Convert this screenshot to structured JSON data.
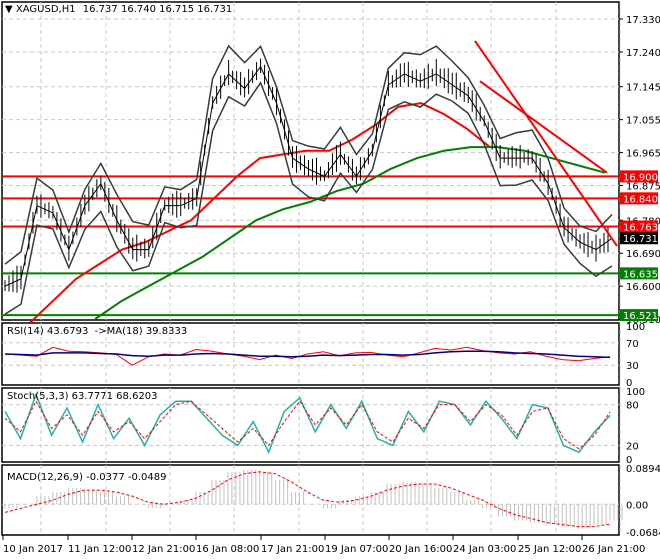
{
  "header": {
    "symbol_label": "XAGUSD,H1",
    "ohlc": "16.737 16.740 16.715 16.731"
  },
  "colors": {
    "up_down_bars": "#000000",
    "bands": "#2f3f3f",
    "ma_fast": "#ff0000",
    "ma_slow": "#008000",
    "resistance": "#ff0000",
    "support": "#008000",
    "rsi": "#ff0000",
    "rsi_ma": "#000080",
    "stoch_main": "#20b2aa",
    "stoch_signal": "#ff0000",
    "macd_hist": "#c0c0c0",
    "macd_signal": "#ff0000"
  },
  "chart_data": [
    {
      "type": "line",
      "title": "XAGUSD,H1",
      "ylim": [
        16.51,
        17.33
      ],
      "y_ticks": [
        "17.330",
        "17.240",
        "17.145",
        "17.055",
        "16.965",
        "16.875",
        "16.780",
        "16.690",
        "16.600",
        "16.510"
      ],
      "x_ticks": [
        "10 Jan 2017",
        "11 Jan 12:00",
        "12 Jan 21:00",
        "16 Jan 08:00",
        "17 Jan 21:00",
        "19 Jan 07:00",
        "20 Jan 16:00",
        "24 Jan 03:00",
        "25 Jan 12:00",
        "26 Jan 21:00"
      ],
      "grid": true,
      "price": [
        16.6,
        16.62,
        16.82,
        16.8,
        16.7,
        16.82,
        16.88,
        16.78,
        16.7,
        16.7,
        16.82,
        16.82,
        16.84,
        17.1,
        17.18,
        17.14,
        17.2,
        17.1,
        16.95,
        16.92,
        16.9,
        16.96,
        16.9,
        16.97,
        17.15,
        17.18,
        17.16,
        17.18,
        17.15,
        17.12,
        17.05,
        16.95,
        16.95,
        16.95,
        16.88,
        16.76,
        16.72,
        16.7,
        16.731
      ],
      "ma_fast": [
        16.5,
        16.56,
        16.62,
        16.66,
        16.7,
        16.72,
        16.75,
        16.78,
        16.84,
        16.9,
        16.95,
        16.96,
        16.97,
        16.97,
        17.0,
        17.04,
        17.09,
        17.1,
        17.07,
        17.03,
        16.98
      ],
      "ma_slow": [
        16.51,
        16.56,
        16.6,
        16.64,
        16.68,
        16.73,
        16.78,
        16.81,
        16.83,
        16.86,
        16.88,
        16.92,
        16.95,
        16.97,
        16.98,
        16.98,
        16.97,
        16.95,
        16.93,
        16.91
      ],
      "horizontal_levels": [
        {
          "value": 16.9,
          "label": "16.900",
          "kind": "resistance"
        },
        {
          "value": 16.84,
          "label": "16.840",
          "kind": "resistance"
        },
        {
          "value": 16.763,
          "label": "16.763",
          "kind": "resistance"
        },
        {
          "value": 16.635,
          "label": "16.635",
          "kind": "support"
        },
        {
          "value": 16.521,
          "label": "16.521",
          "kind": "support"
        }
      ],
      "current_price": {
        "value": 16.731,
        "label": "16.731"
      },
      "trendlines": [
        {
          "from": 17.27,
          "to": 16.71
        },
        {
          "from": 17.16,
          "to": 16.91
        }
      ]
    },
    {
      "type": "line",
      "title": "RSI(14) 43.6793  ->MA(18) 39.8333",
      "ylim": [
        0,
        100
      ],
      "y_ticks": [
        "100",
        "70",
        "30",
        "0"
      ],
      "series": [
        {
          "name": "RSI(14)",
          "values": [
            50,
            48,
            46,
            62,
            55,
            54,
            52,
            49,
            30,
            45,
            50,
            48,
            58,
            55,
            50,
            46,
            40,
            48,
            42,
            50,
            54,
            47,
            52,
            53,
            48,
            45,
            52,
            60,
            57,
            62,
            56,
            52,
            50,
            54,
            46,
            40,
            38,
            42,
            45
          ]
        },
        {
          "name": "MA(18)",
          "values": [
            50,
            49,
            48,
            52,
            52,
            52,
            51,
            50,
            47,
            46,
            48,
            48,
            50,
            51,
            50,
            48,
            46,
            46,
            45,
            46,
            48,
            47,
            48,
            49,
            49,
            48,
            49,
            52,
            54,
            55,
            55,
            54,
            52,
            51,
            50,
            48,
            46,
            45,
            44
          ]
        }
      ]
    },
    {
      "type": "line",
      "title": "Stoch(5,3,3) 63.7771 68.6203",
      "ylim": [
        0,
        100
      ],
      "y_ticks": [
        "100",
        "80",
        "20",
        "0"
      ],
      "series": [
        {
          "name": "main",
          "values": [
            70,
            30,
            95,
            35,
            75,
            25,
            80,
            30,
            60,
            20,
            65,
            85,
            85,
            60,
            35,
            20,
            55,
            10,
            70,
            90,
            40,
            80,
            45,
            85,
            30,
            20,
            70,
            40,
            85,
            80,
            50,
            85,
            60,
            30,
            80,
            75,
            20,
            10,
            40,
            64
          ]
        },
        {
          "name": "signal",
          "values": [
            60,
            40,
            85,
            45,
            65,
            35,
            70,
            40,
            55,
            30,
            55,
            80,
            85,
            65,
            45,
            25,
            45,
            20,
            55,
            85,
            50,
            75,
            50,
            80,
            40,
            25,
            60,
            45,
            80,
            80,
            55,
            80,
            65,
            35,
            70,
            75,
            30,
            15,
            35,
            69
          ]
        }
      ]
    },
    {
      "type": "bar",
      "title": "MACD(12,26,9) -0.0377 -0.0489",
      "ylim": [
        -0.0684,
        0.0894
      ],
      "y_ticks": [
        "0.0894",
        "0.00",
        "-0.0684"
      ],
      "series": [
        {
          "name": "histogram",
          "values": [
            -0.01,
            0.0,
            0.02,
            0.03,
            0.04,
            0.035,
            0.03,
            0.02,
            0.0,
            -0.01,
            0.0,
            0.01,
            0.03,
            0.06,
            0.08,
            0.085,
            0.08,
            0.06,
            0.03,
            0.0,
            -0.01,
            0.01,
            0.02,
            0.03,
            0.05,
            0.055,
            0.05,
            0.04,
            0.03,
            0.01,
            -0.01,
            -0.03,
            -0.04,
            -0.045,
            -0.05,
            -0.055,
            -0.06,
            -0.05,
            -0.04
          ]
        },
        {
          "name": "signal",
          "values": [
            -0.02,
            -0.01,
            0.0,
            0.01,
            0.025,
            0.035,
            0.035,
            0.03,
            0.02,
            0.005,
            0.0,
            0.005,
            0.015,
            0.035,
            0.06,
            0.075,
            0.08,
            0.075,
            0.055,
            0.03,
            0.01,
            0.005,
            0.01,
            0.02,
            0.035,
            0.045,
            0.05,
            0.05,
            0.04,
            0.025,
            0.01,
            -0.01,
            -0.025,
            -0.035,
            -0.045,
            -0.05,
            -0.055,
            -0.055,
            -0.049
          ]
        }
      ]
    }
  ]
}
